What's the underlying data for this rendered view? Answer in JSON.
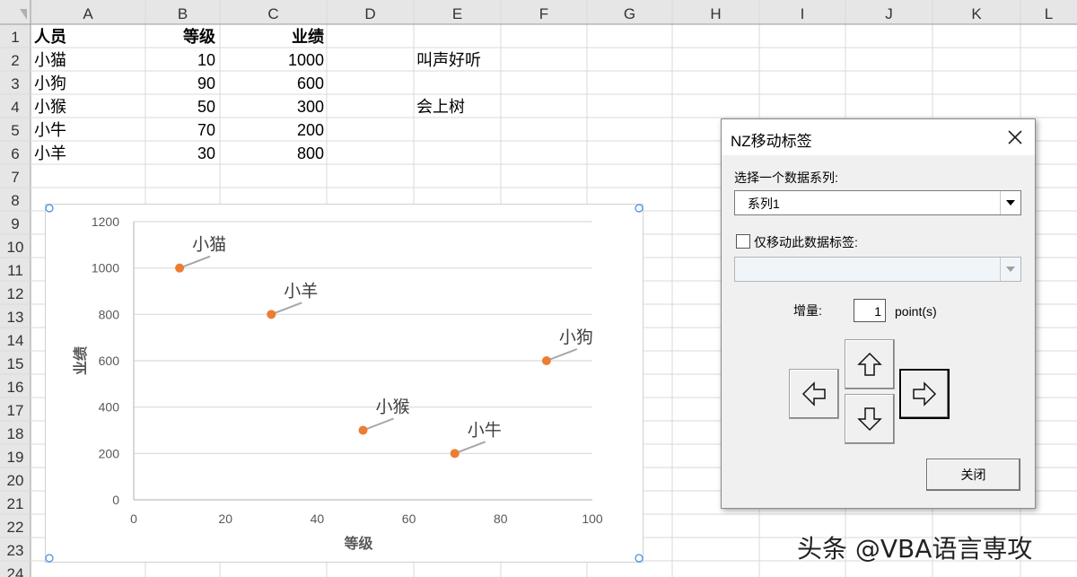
{
  "sheet": {
    "columns": [
      "A",
      "B",
      "C",
      "D",
      "E",
      "F",
      "G",
      "H",
      "I",
      "J",
      "K",
      "L"
    ],
    "rows": [
      "1",
      "2",
      "3",
      "4",
      "5",
      "6",
      "7",
      "8",
      "9",
      "10",
      "11",
      "12",
      "13",
      "14",
      "15",
      "16",
      "17",
      "18",
      "19",
      "20",
      "21",
      "22",
      "23",
      "24"
    ],
    "header": {
      "name": "人员",
      "level": "等级",
      "score": "业绩"
    },
    "records": [
      {
        "name": "小猫",
        "level": "10",
        "score": "1000"
      },
      {
        "name": "小狗",
        "level": "90",
        "score": "600"
      },
      {
        "name": "小猴",
        "level": "50",
        "score": "300"
      },
      {
        "name": "小牛",
        "level": "70",
        "score": "200"
      },
      {
        "name": "小羊",
        "level": "30",
        "score": "800"
      }
    ],
    "notes": {
      "e2": "叫声好听",
      "e4": "会上树"
    }
  },
  "chart_data": {
    "type": "scatter",
    "title": "",
    "xlabel": "等级",
    "ylabel": "业绩",
    "xlim": [
      0,
      100
    ],
    "ylim": [
      0,
      1200
    ],
    "xticks": [
      0,
      20,
      40,
      60,
      80,
      100
    ],
    "yticks": [
      0,
      200,
      400,
      600,
      800,
      1000,
      1200
    ],
    "grid": "horizontal",
    "marker_color": "#ED7D31",
    "points": [
      {
        "label": "小猫",
        "x": 10,
        "y": 1000
      },
      {
        "label": "小狗",
        "x": 90,
        "y": 600
      },
      {
        "label": "小猴",
        "x": 50,
        "y": 300
      },
      {
        "label": "小牛",
        "x": 70,
        "y": 200
      },
      {
        "label": "小羊",
        "x": 30,
        "y": 800
      }
    ]
  },
  "dialog": {
    "title": "NZ移动标签",
    "series_label": "选择一个数据系列:",
    "series_value": "系列1",
    "only_label_text": "仅移动此数据标签:",
    "only_label_checked": false,
    "increment_label": "增量:",
    "increment_value": "1",
    "increment_unit": "point(s)",
    "close_button": "关闭"
  },
  "watermark": "头条 @VBA语言専攻"
}
